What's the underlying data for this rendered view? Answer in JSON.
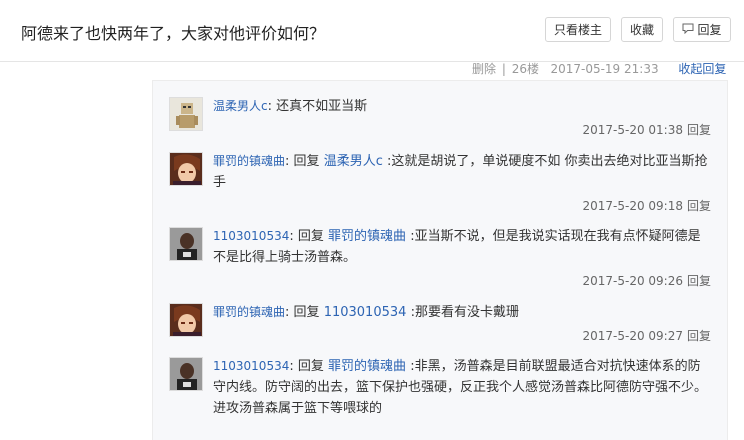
{
  "header": {
    "title": "阿德来了也快两年了，大家对他评价如何？",
    "only_op": "只看楼主",
    "favorite": "收藏",
    "reply": "回复"
  },
  "post_meta": {
    "delete": "删除",
    "separator": "|",
    "floor": "26楼",
    "time": "2017-05-19 21:33",
    "collapse": "收起回复"
  },
  "replies": [
    {
      "user": "温柔男人c",
      "colon": ":",
      "reply_word": "",
      "reply_to": "",
      "content": "还真不如亚当斯",
      "time": "2017-5-20 01:38",
      "action": "回复",
      "avatar_icon": "doll-avatar-icon"
    },
    {
      "user": "罪罚的镇魂曲",
      "colon": ":",
      "reply_word": "回复",
      "reply_to": "温柔男人c",
      "content": ":这就是胡说了，单说硬度不如 你卖出去绝对比亚当斯抢手",
      "time": "2017-5-20 09:18",
      "action": "回复",
      "avatar_icon": "anime-avatar-icon"
    },
    {
      "user": "1103010534",
      "colon": ":",
      "reply_word": "回复",
      "reply_to": "罪罚的镇魂曲",
      "content": ":亚当斯不说，但是我说实话现在我有点怀疑阿德是不是比得上骑士汤普森。",
      "time": "2017-5-20 09:26",
      "action": "回复",
      "avatar_icon": "player-avatar-icon"
    },
    {
      "user": "罪罚的镇魂曲",
      "colon": ":",
      "reply_word": "回复",
      "reply_to": "1103010534",
      "content": ":那要看有没卡戴珊",
      "time": "2017-5-20 09:27",
      "action": "回复",
      "avatar_icon": "anime-avatar-icon"
    },
    {
      "user": "1103010534",
      "colon": ":",
      "reply_word": "回复",
      "reply_to": "罪罚的镇魂曲",
      "content": ":非黑，汤普森是目前联盟最适合对抗快速体系的防守内线。防守阔的出去，篮下保护也强硬，反正我个人感觉汤普森比阿德防守强不少。进攻汤普森属于篮下等喂球的",
      "time": "",
      "action": "",
      "avatar_icon": "player-avatar-icon"
    }
  ],
  "colors": {
    "link": "#2d64b3",
    "panel_bg": "#f7f8fa"
  }
}
